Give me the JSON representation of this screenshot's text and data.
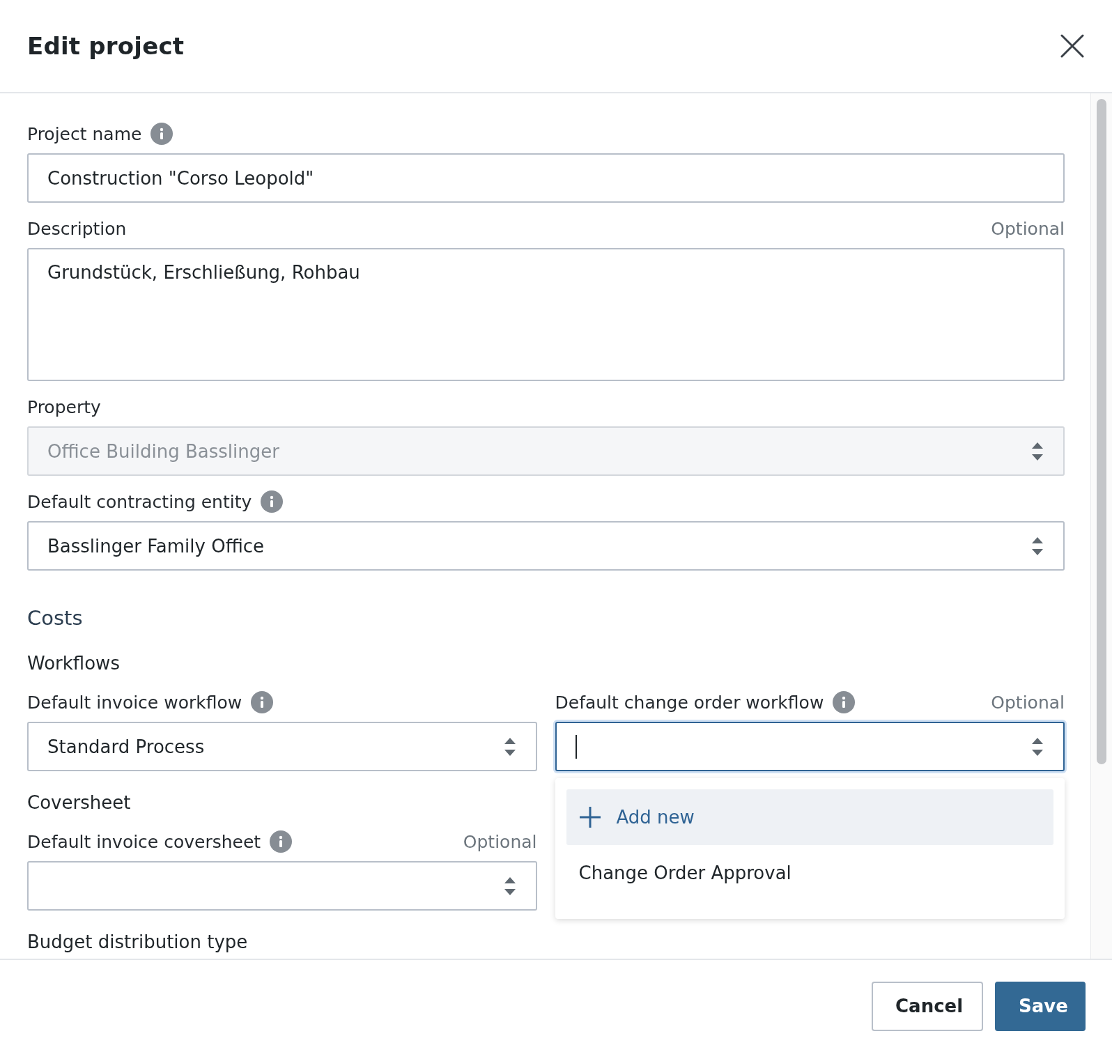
{
  "dialog": {
    "title": "Edit project"
  },
  "fields": [
    {
      "kind": "text",
      "label": "Project name",
      "info": true,
      "value": "Construction  \"Corso Leopold\""
    },
    {
      "kind": "textarea",
      "label": "Description",
      "optional": "Optional",
      "value": "Grundstück, Erschließung, Rohbau"
    },
    {
      "kind": "select",
      "label": "Property",
      "disabled": true,
      "value": "Office Building Basslinger"
    },
    {
      "kind": "select",
      "label": "Default contracting entity",
      "info": true,
      "disabled": false,
      "value": "Basslinger Family Office"
    }
  ],
  "costs": {
    "heading": "Costs",
    "sections": [
      {
        "heading": "Workflows",
        "fields": [
          {
            "kind": "select",
            "label": "Default invoice workflow",
            "info": true,
            "focused": false,
            "value": "Standard Process"
          },
          {
            "kind": "select",
            "label": "Default change order workflow",
            "info": true,
            "optional": "Optional",
            "focused": true,
            "menu": {
              "items": [
                {
                  "kind": "add",
                  "label": "Add new",
                  "highlighted": true
                },
                {
                  "kind": "option",
                  "label": "Change Order Approval",
                  "highlighted": false
                }
              ]
            }
          }
        ]
      },
      {
        "heading": "Coversheet",
        "fields": [
          {
            "kind": "select",
            "label": "Default invoice coversheet",
            "info": true,
            "optional": "Optional",
            "focused": false
          }
        ]
      },
      {
        "heading": "Budget distribution type"
      }
    ]
  },
  "buttons": [
    {
      "kind": "secondary",
      "label": "Cancel"
    },
    {
      "kind": "primary",
      "label": "Save"
    }
  ]
}
